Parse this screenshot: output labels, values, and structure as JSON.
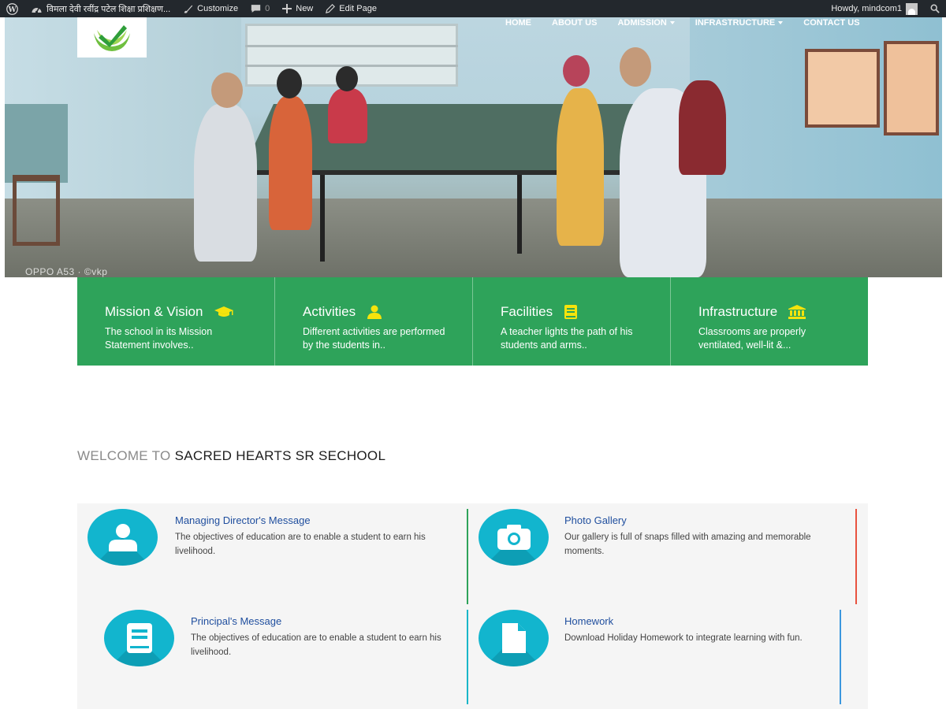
{
  "admin_bar": {
    "site_name": "विमला देवी रवींद्र पटेल शिक्षा प्रशिक्षण...",
    "customize": "Customize",
    "comments_count": "0",
    "new": "New",
    "edit_page": "Edit Page",
    "howdy": "Howdy, mindcom1"
  },
  "hero": {
    "watermark": "OPPO A53 · ©vkp"
  },
  "nav": {
    "items": [
      {
        "label": "HOME"
      },
      {
        "label": "ABOUT US"
      },
      {
        "label": "ADMISSION"
      },
      {
        "label": "INFRASTRUCTURE"
      },
      {
        "label": "CONTACT US"
      }
    ]
  },
  "features": [
    {
      "title": "Mission & Vision",
      "desc": "The school in its Mission Statement involves..",
      "icon": "graduation-cap-icon"
    },
    {
      "title": "Activities",
      "desc": "Different activities are performed by the students in..",
      "icon": "user-icon"
    },
    {
      "title": "Facilities",
      "desc": "A teacher lights the path of his students and arms..",
      "icon": "book-icon"
    },
    {
      "title": "Infrastructure",
      "desc": "Classrooms are properly ventilated, well-lit &...",
      "icon": "institution-icon"
    }
  ],
  "welcome": {
    "prefix": "WELCOME TO",
    "school_name": "SACRED HEARTS SR SECHOOL"
  },
  "cards": [
    {
      "title": "Managing Director's Message",
      "desc": "The objectives of education are to enable a student to earn his livelihood.",
      "icon": "user-icon"
    },
    {
      "title": "Photo Gallery",
      "desc": "Our gallery is full of snaps filled with amazing and memorable moments.",
      "icon": "camera-icon"
    },
    {
      "title": "Principal's Message",
      "desc": "The objectives of education are to enable a student to earn his livelihood.",
      "icon": "book-icon"
    },
    {
      "title": "Homework",
      "desc": "Download Holiday Homework to integrate learning with fun.",
      "icon": "file-icon"
    }
  ],
  "colors": {
    "admin_bar": "#23282d",
    "feature_green": "#2ea35a",
    "feature_icon_yellow": "#f5e30c",
    "card_circle": "#12b5ce",
    "card_title": "#1f4e9e",
    "divider_green": "#2ea35a",
    "divider_red": "#e8523f",
    "divider_teal": "#19b6c8",
    "divider_blue": "#3b97de"
  }
}
